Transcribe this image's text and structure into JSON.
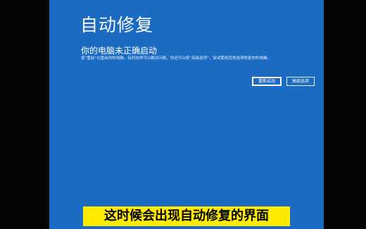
{
  "colors": {
    "background": "#1a6bc1",
    "caption_bg": "#ffeb00"
  },
  "recovery": {
    "title": "自动修复",
    "subtitle": "你的电脑未正确启动",
    "description": "按“重启”以重启你的电脑，有时这样可以解决问题。你还可以按“高级选项”，尝试使用其他选项修复你的电脑。",
    "restart_label": "重新启动",
    "advanced_label": "高级选项"
  },
  "caption": {
    "text": "这时候会出现自动修复的界面"
  }
}
